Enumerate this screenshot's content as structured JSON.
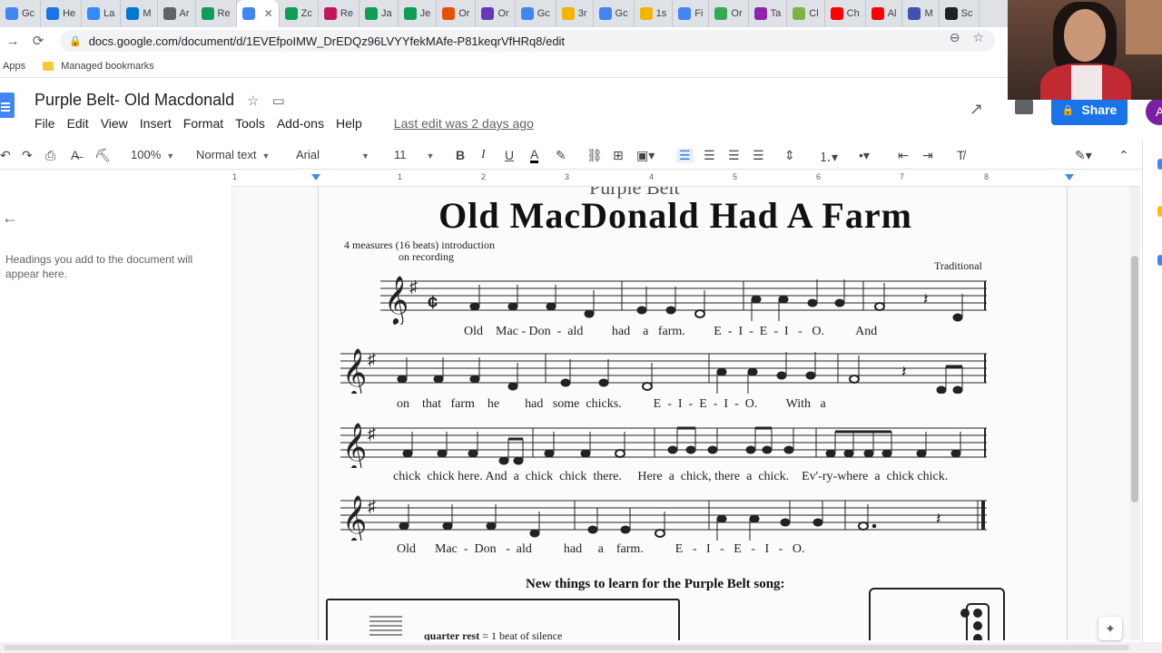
{
  "browser": {
    "tabs": [
      {
        "label": "Gc",
        "color": "#4285f4"
      },
      {
        "label": "He",
        "color": "#1a73e8"
      },
      {
        "label": "La",
        "color": "#2d8cff"
      },
      {
        "label": "M",
        "color": "#0078d4"
      },
      {
        "label": "Ar",
        "color": "#5f6368"
      },
      {
        "label": "Re",
        "color": "#0f9d58"
      },
      {
        "label": "",
        "color": "#4285f4",
        "active": true
      },
      {
        "label": "Zc",
        "color": "#0f9d58"
      },
      {
        "label": "Re",
        "color": "#c2185b"
      },
      {
        "label": "Ja",
        "color": "#0f9d58"
      },
      {
        "label": "Je",
        "color": "#0f9d58"
      },
      {
        "label": "Or",
        "color": "#e65100"
      },
      {
        "label": "Or",
        "color": "#673ab7"
      },
      {
        "label": "Gc",
        "color": "#4285f4"
      },
      {
        "label": "3r",
        "color": "#f4b400"
      },
      {
        "label": "Gc",
        "color": "#4285f4"
      },
      {
        "label": "1s",
        "color": "#f4b400"
      },
      {
        "label": "Fi",
        "color": "#4285f4"
      },
      {
        "label": "Or",
        "color": "#34a853"
      },
      {
        "label": "Ta",
        "color": "#8e24aa"
      },
      {
        "label": "Cl",
        "color": "#7cb342"
      },
      {
        "label": "Ch",
        "color": "#ff0000"
      },
      {
        "label": "Al",
        "color": "#ff0000"
      },
      {
        "label": "M",
        "color": "#3f51b5"
      },
      {
        "label": "Sc",
        "color": "#212121"
      }
    ],
    "url": "docs.google.com/document/d/1EVEfpoIMW_DrEDQz96LVYYfekMAfe-P81keqrVfHRq8/edit",
    "bookmarks": {
      "apps": "Apps",
      "managed": "Managed bookmarks"
    }
  },
  "doc": {
    "title": "Purple Belt- Old Macdonald",
    "menu": [
      "File",
      "Edit",
      "View",
      "Insert",
      "Format",
      "Tools",
      "Add-ons",
      "Help"
    ],
    "last_edit": "Last edit was 2 days ago",
    "share_label": "Share",
    "avatar_letter": "A"
  },
  "toolbar": {
    "zoom": "100%",
    "style": "Normal text",
    "font": "Arial",
    "size": "11"
  },
  "ruler": [
    "1",
    "1",
    "2",
    "3",
    "4",
    "5",
    "6",
    "7",
    "8"
  ],
  "outline": {
    "hint": "Headings you add to the document will appear here."
  },
  "sheet": {
    "top_cut": "Purple Belt",
    "title": "Old MacDonald Had A Farm",
    "intro_line1": "4 measures (16 beats) introduction",
    "intro_line2": "on recording",
    "credit": "Traditional",
    "lyrics": [
      "Old    Mac - Don  -  ald         had    a   farm.         E  -  I  -  E  -  I   -   O.          And",
      "on    that   farm    he        had   some  chicks.          E  -  I  -  E  -  I  -  O.         With   a",
      "chick  chick here. And  a  chick  chick  there.     Here  a  chick, there  a  chick.    Ev'-ry-where  a  chick chick.",
      "Old      Mac  -  Don   -  ald          had     a    farm.          E   -   I   -   E   -   I   -   O."
    ],
    "learn_heading": "New things to learn for the Purple Belt song:",
    "box_term": "quarter rest",
    "box_def": "= 1 beat of silence"
  }
}
